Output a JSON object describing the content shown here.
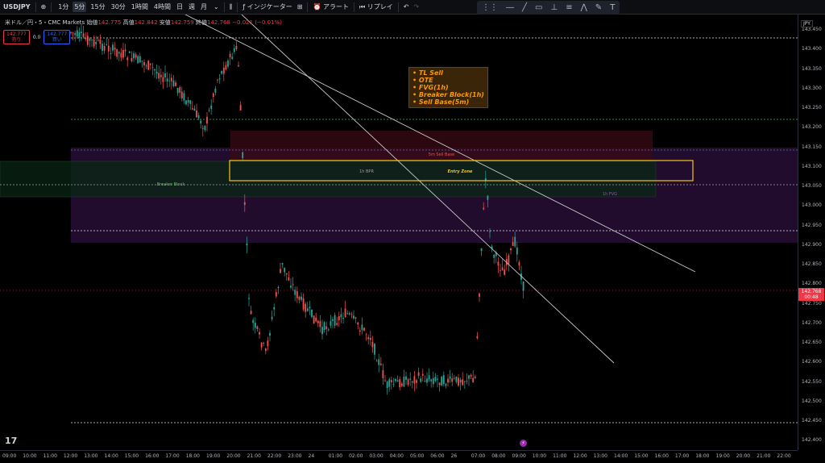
{
  "toolbar": {
    "symbol": "USDJPY",
    "add_symbol_icon": "plus-circle-icon",
    "timeframes": [
      "1分",
      "5分",
      "15分",
      "30分",
      "1時間",
      "4時間",
      "日",
      "週",
      "月"
    ],
    "active_timeframe": "5分",
    "indicators_label": "インジケーター",
    "alert_label": "アラート",
    "replay_label": "リプレイ",
    "drawing_tools": [
      "cursor-icon",
      "horizontal-line-icon",
      "trend-line-icon",
      "rectangle-icon",
      "long-position-icon",
      "fib-icon",
      "path-icon",
      "brush-icon",
      "text-icon"
    ]
  },
  "symbol_info": {
    "name": "米ドル／円・5・CMC Markets",
    "open_label": "始値",
    "open": "142.775",
    "high_label": "高値",
    "high": "142.842",
    "low_label": "安値",
    "low": "142.759",
    "close_label": "終値",
    "close": "142.768",
    "change": "−0.021 (−0.01%)"
  },
  "trade_boxes": {
    "sell_price": "142.777",
    "sell_label": "売り",
    "spread": "0.0",
    "buy_price": "142.777",
    "buy_label": "買い"
  },
  "currency": "JPY",
  "current_price": {
    "price": "142.768",
    "countdown": "00:48"
  },
  "annotation_lines": [
    "• TL Sell",
    "• OTE",
    "• FVG(1h)",
    "• Breaker Block(1h)",
    "• Sell Base(5m)"
  ],
  "chart_labels": {
    "sell_base": "5m Sell Base",
    "bpr": "1h BPR",
    "entry_zone": "Entry Zone",
    "breaker_block": "Breaker Block",
    "fvg": "1h FVG"
  },
  "price_ticks": [
    "143.450",
    "143.400",
    "143.350",
    "143.300",
    "143.250",
    "143.200",
    "143.150",
    "143.100",
    "143.050",
    "143.000",
    "142.950",
    "142.900",
    "142.850",
    "142.800",
    "142.750",
    "142.700",
    "142.650",
    "142.600",
    "142.550",
    "142.500",
    "142.450",
    "142.400"
  ],
  "time_ticks": [
    "09:00",
    "10:00",
    "11:00",
    "12:00",
    "13:00",
    "14:00",
    "15:00",
    "16:00",
    "17:00",
    "18:00",
    "19:00",
    "20:00",
    "21:00",
    "22:00",
    "23:00",
    "24",
    "01:00",
    "02:00",
    "03:00",
    "04:00",
    "05:00",
    "06:00",
    "26",
    "07:00",
    "08:00",
    "09:00",
    "10:00",
    "11:00",
    "12:00",
    "13:00",
    "14:00",
    "15:00",
    "16:00",
    "17:00",
    "18:00",
    "19:00",
    "20:00",
    "21:00",
    "22:00"
  ],
  "colors": {
    "up": "#26a69a",
    "down": "#ef5350",
    "entry_zone": "#f5c518",
    "annotation_text": "#ff9800",
    "fvg": "#9c27b0",
    "breaker": "#4caf50",
    "trendline": "#c8c8c8"
  },
  "logo_text": "17"
}
